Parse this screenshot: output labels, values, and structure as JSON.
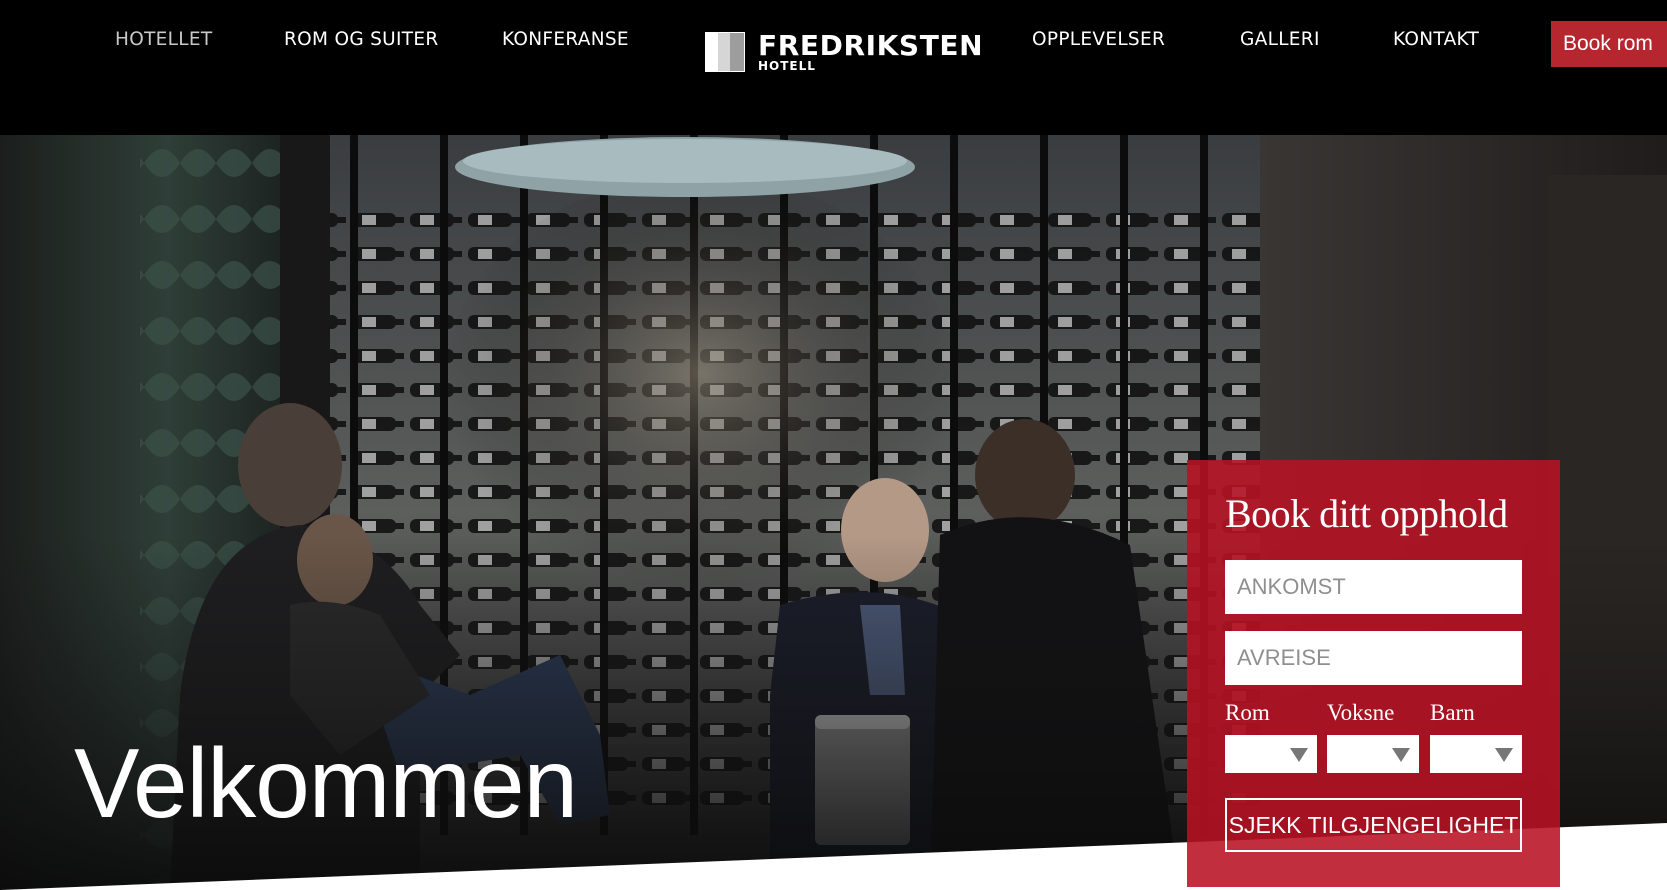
{
  "nav": {
    "items": [
      {
        "label": "HOTELLET",
        "active": true
      },
      {
        "label": "ROM OG SUITER",
        "active": false
      },
      {
        "label": "KONFERANSE",
        "active": false
      },
      {
        "label": "OPPLEVELSER",
        "active": false
      },
      {
        "label": "GALLERI",
        "active": false
      },
      {
        "label": "KONTAKT",
        "active": false
      }
    ],
    "book_label": "Book rom"
  },
  "logo": {
    "name": "FREDRIKSTEN",
    "sub": "HOTELL"
  },
  "hero": {
    "headline": "Velkommen"
  },
  "booking": {
    "title": "Book ditt opphold",
    "arrival_placeholder": "ANKOMST",
    "departure_placeholder": "AVREISE",
    "rooms_label": "Rom",
    "adults_label": "Voksne",
    "children_label": "Barn",
    "submit_label": "SJEKK TILGJENGELIGHET"
  },
  "colors": {
    "accent": "#b5262f",
    "panel": "#b81224"
  }
}
